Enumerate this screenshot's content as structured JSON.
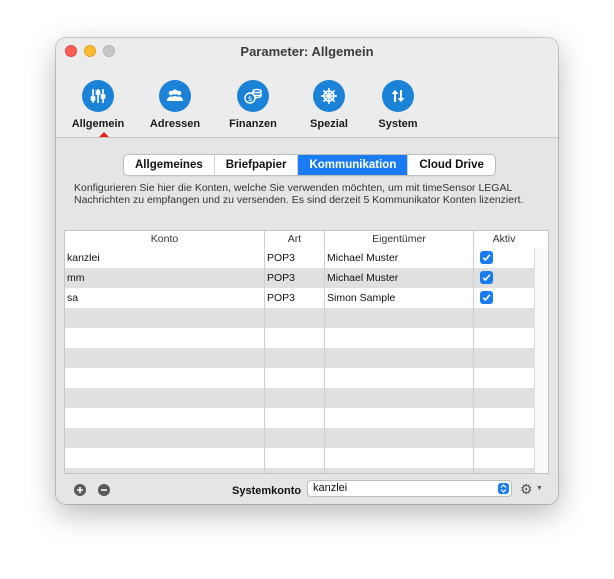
{
  "window": {
    "title": "Parameter: Allgemein"
  },
  "toolbar": {
    "items": [
      {
        "label": "Allgemein",
        "icon": "sliders-icon",
        "selected": true
      },
      {
        "label": "Adressen",
        "icon": "people-icon"
      },
      {
        "label": "Finanzen",
        "icon": "coins-icon"
      },
      {
        "label": "Spezial",
        "icon": "wheel-icon"
      },
      {
        "label": "System",
        "icon": "arrows-icon"
      }
    ]
  },
  "tabs": [
    {
      "label": "Allgemeines"
    },
    {
      "label": "Briefpapier"
    },
    {
      "label": "Kommunikation",
      "active": true
    },
    {
      "label": "Cloud Drive"
    }
  ],
  "description": "Konfigurieren Sie hier die Konten, welche Sie verwenden möchten, um mit timeSensor LEGAL Nachrichten zu empfangen und zu versenden. Es sind derzeit 5 Kommunikator Konten lizenziert.",
  "table": {
    "headers": {
      "konto": "Konto",
      "art": "Art",
      "eigentuemer": "Eigentümer",
      "aktiv": "Aktiv"
    },
    "rows": [
      {
        "konto": "kanzlei",
        "art": "POP3",
        "eigentuemer": "Michael Muster",
        "aktiv": true
      },
      {
        "konto": "mm",
        "art": "POP3",
        "eigentuemer": "Michael Muster",
        "aktiv": true
      },
      {
        "konto": "sa",
        "art": "POP3",
        "eigentuemer": "Simon Sample",
        "aktiv": true
      }
    ]
  },
  "bottom": {
    "systemkonto_label": "Systemkonto",
    "systemkonto_value": "kanzlei",
    "add_icon": "plus-circle-icon",
    "remove_icon": "minus-circle-icon",
    "gear_icon": "gear-icon"
  },
  "colors": {
    "accent": "#1a7cf4",
    "toolbar_icon": "#1b82d8",
    "selection_marker": "#e0241f"
  }
}
